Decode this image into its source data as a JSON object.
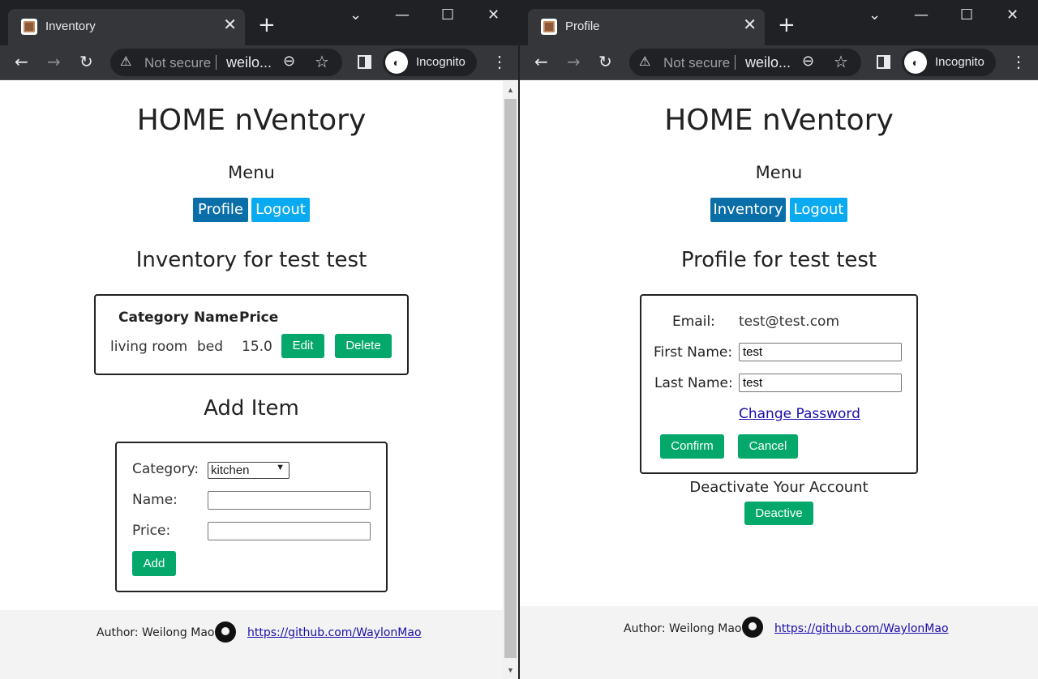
{
  "left": {
    "tab_title": "Inventory",
    "omnibox": {
      "security": "Not secure",
      "url": "weilo..."
    },
    "incognito_label": "Incognito",
    "app_title": "HOME nVentory",
    "menu_heading": "Menu",
    "nav": {
      "profile": "Profile",
      "logout": "Logout"
    },
    "inventory_heading": "Inventory for test test",
    "table": {
      "headers": [
        "Category",
        "Name",
        "Price"
      ],
      "rows": [
        {
          "category": "living room",
          "name": "bed",
          "price": "15.0",
          "edit": "Edit",
          "delete": "Delete"
        }
      ]
    },
    "add_item": {
      "heading": "Add Item",
      "category_label": "Category:",
      "category_value": "kitchen",
      "name_label": "Name:",
      "name_value": "",
      "price_label": "Price:",
      "price_value": "",
      "add_button": "Add"
    },
    "footer": {
      "author": "Author: Weilong Mao",
      "link": "https://github.com/WaylonMao"
    }
  },
  "right": {
    "tab_title": "Profile",
    "omnibox": {
      "security": "Not secure",
      "url": "weilo..."
    },
    "incognito_label": "Incognito",
    "app_title": "HOME nVentory",
    "menu_heading": "Menu",
    "nav": {
      "inventory": "Inventory",
      "logout": "Logout"
    },
    "profile_heading": "Profile for test test",
    "form": {
      "email_label": "Email:",
      "email_value": "test@test.com",
      "first_label": "First Name:",
      "first_value": "test",
      "last_label": "Last Name:",
      "last_value": "test",
      "change_password": "Change Password",
      "confirm": "Confirm",
      "cancel": "Cancel"
    },
    "deactivate_heading": "Deactivate Your Account",
    "deactivate_button": "Deactive",
    "footer": {
      "author": "Author: Weilong Mao",
      "link": "https://github.com/WaylonMao"
    }
  },
  "colors": {
    "green": "#04a86a",
    "nav_dark": "#0a6ea8",
    "nav_light": "#0aaaf0",
    "chrome": "#202124"
  },
  "icons": [
    "favicon-icon",
    "close-icon",
    "plus-icon",
    "minimize-icon",
    "maximize-icon",
    "back-arrow-icon",
    "forward-arrow-icon",
    "reload-icon",
    "warning-icon",
    "zoom-icon",
    "star-icon",
    "side-panel-icon",
    "incognito-icon",
    "kebab-menu-icon",
    "github-icon"
  ]
}
